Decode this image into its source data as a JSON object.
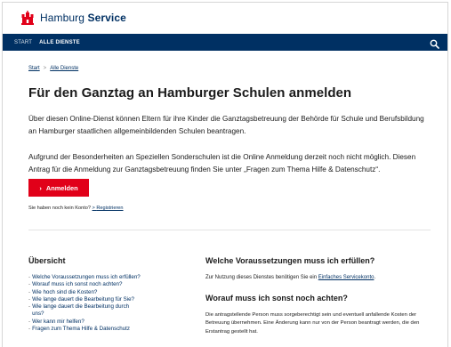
{
  "header": {
    "brand_regular": "Hamburg",
    "brand_bold": "Service"
  },
  "nav": {
    "items": [
      {
        "label": "START"
      },
      {
        "label": "ALLE DIENSTE"
      }
    ],
    "search_icon": "search-icon"
  },
  "breadcrumb": {
    "items": [
      "Start",
      "Alle Dienste"
    ],
    "separator": ">"
  },
  "main": {
    "title": "Für den Ganztag an Hamburger Schulen anmelden",
    "intro": "Über diesen Online-Dienst können Eltern für ihre Kinder die Ganztagsbetreuung der Behörde für Schule und Berufsbildung an Hamburger staatlichen allgemeinbildenden Schulen beantragen.",
    "notice": "Aufgrund der Besonderheiten an Speziellen Sonderschulen ist die Online Anmeldung derzeit noch nicht möglich. Diesen Antrag für die Anmeldung zur Ganztagsbetreuung finden Sie unter „Fragen zum Thema Hilfe & Datenschutz“.",
    "cta_label": "Anmelden",
    "signup_text": "Sie haben noch kein Konto?",
    "signup_link": "Registrieren"
  },
  "overview": {
    "title": "Übersicht",
    "items": [
      "Welche Voraussetzungen muss ich erfüllen?",
      "Worauf muss ich sonst noch achten?",
      "Wie hoch sind die Kosten?",
      "Wie lange dauert die Bearbeitung für Sie?",
      "Wie lange dauert die Bearbeitung durch",
      "uns?",
      "Wer kann mir helfen?",
      "Fragen zum Thema Hilfe & Datenschutz"
    ]
  },
  "faq": {
    "q1": "Welche Voraussetzungen muss ich erfüllen?",
    "a1_text": "Zur Nutzung dieses Dienstes benötigen Sie ein",
    "a1_link": "Einfaches Servicekonto",
    "a1_end": ".",
    "q2": "Worauf muss ich sonst noch achten?",
    "a2": "Die antragstellende Person muss sorgeberechtigt sein und eventuell anfallende Kosten der Betreuung übernehmen. Eine Änderung kann nur von der Person beantragt werden, die den Erstantrag gestellt hat."
  },
  "colors": {
    "brand_navy": "#003063",
    "accent_red": "#e10019"
  }
}
